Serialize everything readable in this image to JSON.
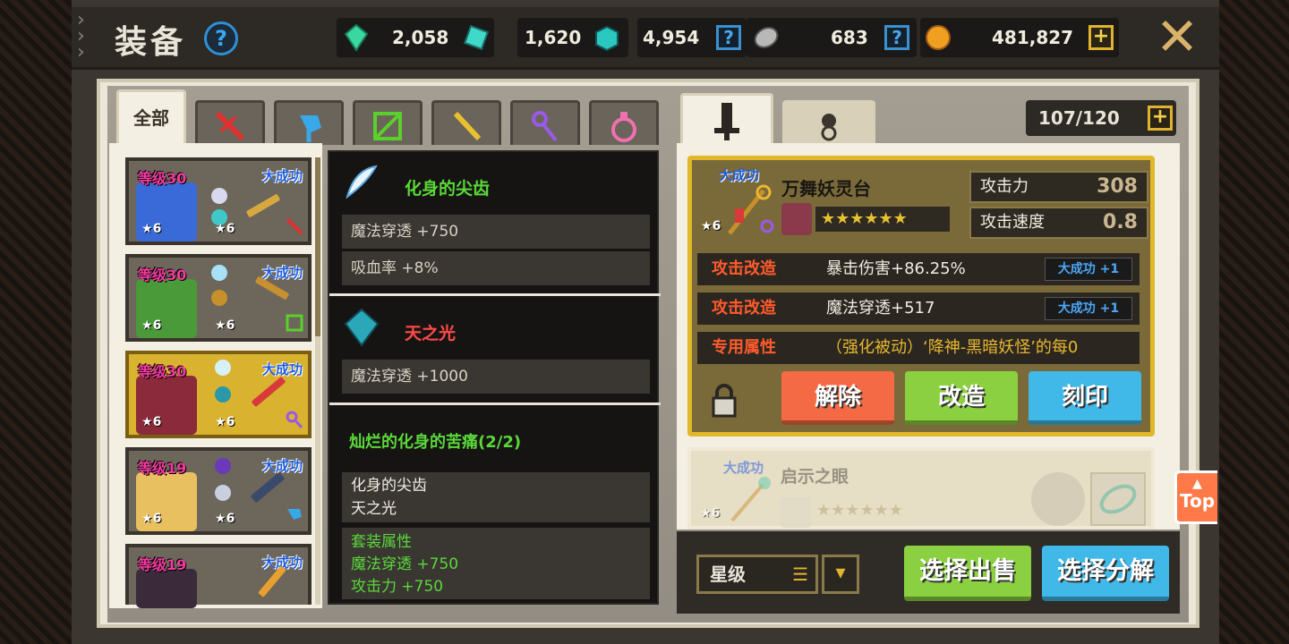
{
  "header": {
    "title": "装备",
    "help_icon": "?",
    "resources": [
      {
        "icon": "green-gem-icon",
        "value": "2,058"
      },
      {
        "icon": "cyan-gem-icon",
        "value": "1,620"
      },
      {
        "icon": "teal-crystal-icon",
        "value": "4,954"
      },
      {
        "icon": "grey-stone-icon",
        "value": "683"
      },
      {
        "icon": "gold-coin-icon",
        "value": "481,827"
      }
    ],
    "add_symbol": "+",
    "help_symbol": "?",
    "close_symbol": "✕"
  },
  "category_tabs": [
    {
      "label": "全部",
      "active": true
    },
    {
      "icon": "sword-icon",
      "color": "#e03030"
    },
    {
      "icon": "axe-icon",
      "color": "#38a8e8"
    },
    {
      "icon": "bow-icon",
      "color": "#5ad02a"
    },
    {
      "icon": "gun-icon",
      "color": "#e8c030"
    },
    {
      "icon": "staff-icon",
      "color": "#9a5ae8"
    },
    {
      "icon": "orb-icon",
      "color": "#f070b0"
    }
  ],
  "heroes": [
    {
      "level": "等级30",
      "great": "大成功",
      "star1": "6",
      "star2": "6",
      "color": "#3a6ad8",
      "selected": false
    },
    {
      "level": "等级30",
      "great": "大成功",
      "star1": "6",
      "star2": "6",
      "color": "#4a9a3a",
      "selected": false
    },
    {
      "level": "等级30",
      "great": "大成功",
      "star1": "6",
      "star2": "6",
      "color": "#8a2a3a",
      "selected": true
    },
    {
      "level": "等级19",
      "great": "大成功",
      "star1": "6",
      "star2": "6",
      "color": "#e8c060",
      "selected": false
    },
    {
      "level": "等级19",
      "great": "大成功",
      "star1": "",
      "star2": "",
      "color": "#3a2a3a",
      "selected": false
    }
  ],
  "tooltip": {
    "item1": {
      "name": "化身的尖齿",
      "stats": [
        "魔法穿透 +750",
        "吸血率 +8%"
      ]
    },
    "item2": {
      "name": "天之光",
      "stats": [
        "魔法穿透 +1000"
      ]
    },
    "set": {
      "name": "灿烂的化身的苦痛(2/2)",
      "members": [
        "化身的尖齿",
        "天之光"
      ],
      "attr_title": "套装属性",
      "attrs": [
        "魔法穿透 +750",
        "攻击力 +750"
      ]
    }
  },
  "right_tabs": [
    {
      "icon": "weapon-slot-icon",
      "active": true
    },
    {
      "icon": "accessory-slot-icon",
      "active": false
    }
  ],
  "inventory": {
    "count": "107/120",
    "add": "+"
  },
  "detail": {
    "great": "大成功",
    "stars": "6",
    "name": "万舞妖灵台",
    "rating": "★★★★★★",
    "stats": [
      {
        "label": "攻击力",
        "value": "308"
      },
      {
        "label": "攻击速度",
        "value": "0.8"
      }
    ],
    "mods": [
      {
        "label": "攻击改造",
        "text": "暴击伤害+86.25%",
        "bonus": "大成功 +1"
      },
      {
        "label": "攻击改造",
        "text": "魔法穿透+517",
        "bonus": "大成功 +1"
      },
      {
        "label": "专用属性",
        "text": "（强化被动）‘降神-黑暗妖怪’的每0",
        "bonus": ""
      }
    ],
    "buttons": {
      "release": "解除",
      "modify": "改造",
      "engrave": "刻印"
    }
  },
  "detail2": {
    "great": "大成功",
    "name": "启示之眼",
    "stars": "6",
    "rating": "★★★★★★"
  },
  "bottom": {
    "sort_label": "星级",
    "sell": "选择出售",
    "decompose": "选择分解"
  },
  "top_button": "Top",
  "colors": {
    "gold": "#e2b72a",
    "red_btn": "#f46a44",
    "green_btn": "#8ad040",
    "blue_btn": "#40b8e8"
  }
}
